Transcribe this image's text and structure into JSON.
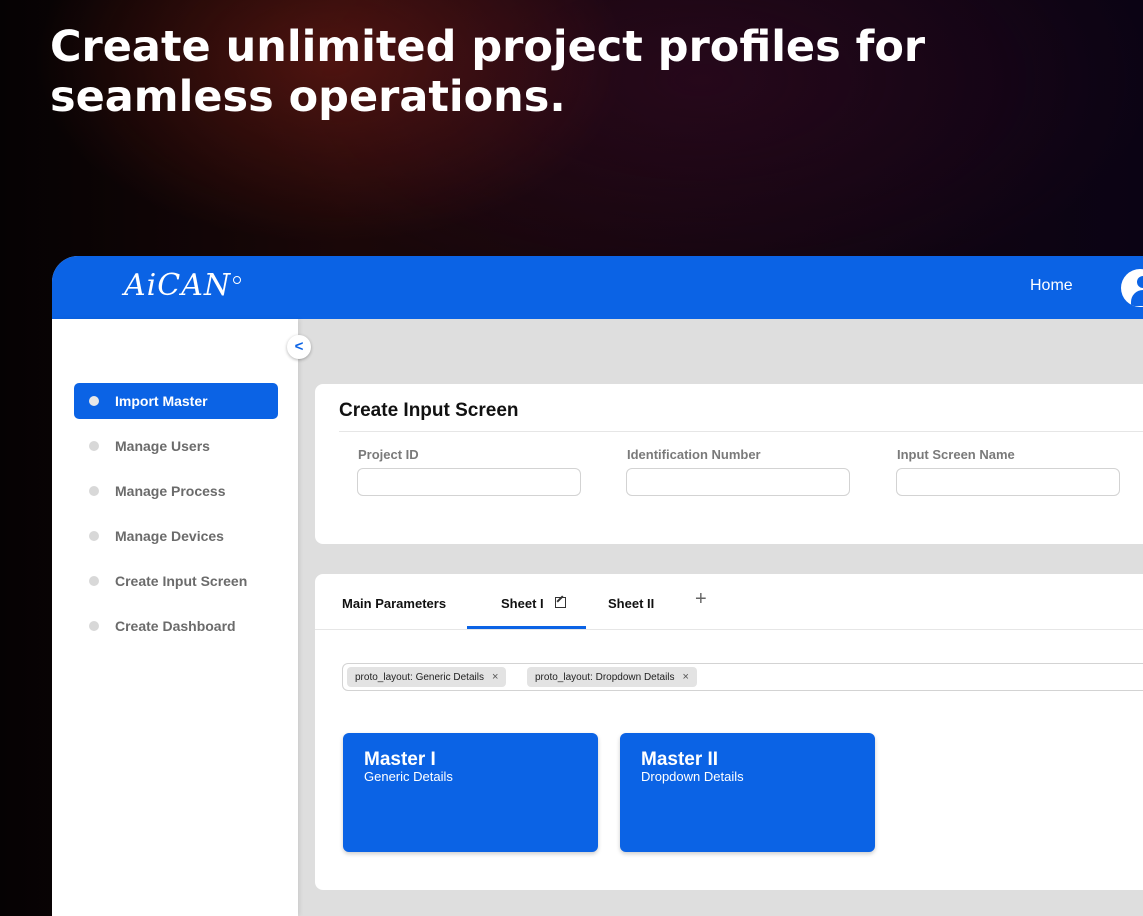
{
  "headline": "Create unlimited project profiles for seamless operations.",
  "brand": {
    "logo_text": "AiCAN"
  },
  "topbar": {
    "home_label": "Home"
  },
  "sidebar": {
    "collapse_glyph": "<",
    "items": [
      {
        "label": "Import Master",
        "active": true
      },
      {
        "label": "Manage Users"
      },
      {
        "label": "Manage Process"
      },
      {
        "label": "Manage Devices"
      },
      {
        "label": "Create Input Screen"
      },
      {
        "label": "Create Dashboard"
      }
    ]
  },
  "form": {
    "title": "Create Input Screen",
    "fields": [
      {
        "label": "Project ID",
        "value": ""
      },
      {
        "label": "Identification Number",
        "value": ""
      },
      {
        "label": "Input Screen Name",
        "value": ""
      }
    ]
  },
  "sheets": {
    "tabs": [
      {
        "label": "Main Parameters"
      },
      {
        "label": "Sheet I",
        "active": true
      },
      {
        "label": "Sheet II"
      }
    ],
    "add_glyph": "+",
    "chips": [
      {
        "label": "proto_layout: Generic Details"
      },
      {
        "label": "proto_layout: Dropdown Details"
      }
    ],
    "chip_remove_glyph": "×",
    "tiles": [
      {
        "title": "Master I",
        "subtitle": "Generic Details"
      },
      {
        "title": "Master II",
        "subtitle": "Dropdown Details"
      }
    ]
  },
  "colors": {
    "brand_blue": "#0b63e5"
  },
  "icons": [
    "user-avatar-icon",
    "chevron-left-icon",
    "edit-icon",
    "plus-icon",
    "close-icon"
  ]
}
